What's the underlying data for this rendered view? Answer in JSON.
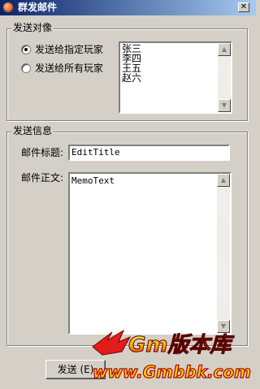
{
  "window": {
    "title": "群发邮件",
    "close_glyph": "✕"
  },
  "recipients_group": {
    "legend": "发送对像",
    "options": [
      {
        "label": "发送给指定玩家",
        "selected": true
      },
      {
        "label": "发送给所有玩家",
        "selected": false
      }
    ],
    "list_items": [
      "张三",
      "李四",
      "王五",
      "赵六"
    ]
  },
  "message_group": {
    "legend": "发送信息",
    "subject_label": "邮件标题:",
    "subject_value": "EditTitle",
    "body_label": "邮件正文:",
    "body_value": "MemoText"
  },
  "buttons": {
    "send_label": "发送",
    "send_accel": "(E)"
  },
  "watermark": {
    "logo_text": "Gm版本库",
    "url_text": "www.Gmbbk.com"
  },
  "colors": {
    "face": "#d4d0c8",
    "titlebar_start": "#0a246a",
    "titlebar_end": "#a6caf0",
    "watermark_red": "#e21b1b",
    "watermark_yellow": "#ffd200"
  },
  "icons": {
    "app": "app-icon",
    "close": "close-icon",
    "scroll_up": "triangle-up-icon",
    "scroll_down": "triangle-down-icon"
  }
}
